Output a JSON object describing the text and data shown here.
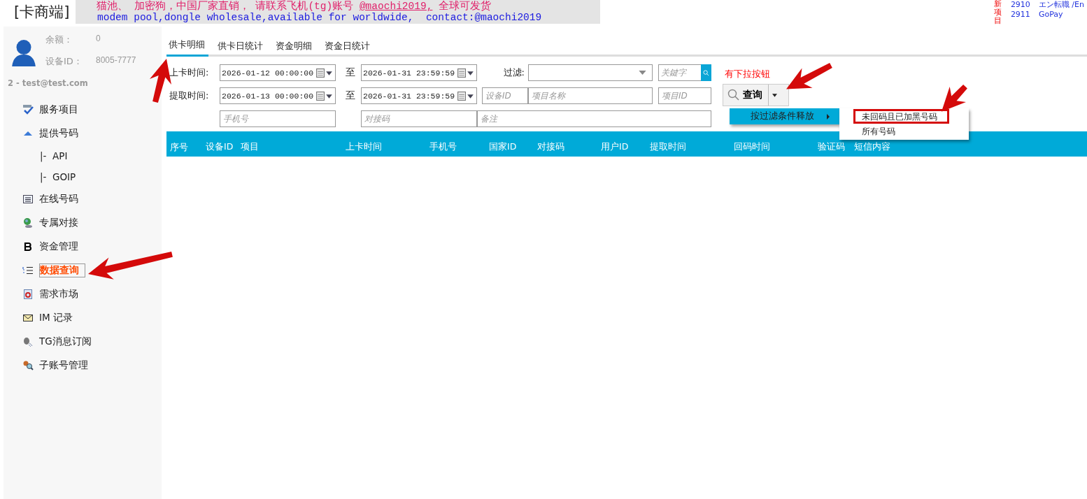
{
  "header": {
    "logo": "[卡商端]",
    "banner": {
      "line1_before": "猫池、 加密狗，中国厂家直销， 请联系飞机(tg)账号 ",
      "line1_link": "@maochi2019,",
      "line1_after": " 全球可发货",
      "line2": "modem pool,dongle wholesale,available for worldwide,  contact:@maochi2019"
    },
    "new_label": "新项目",
    "new_projects": [
      {
        "id": "2910",
        "name": "エン転職 /En"
      },
      {
        "id": "2911",
        "name": "GoPay"
      }
    ]
  },
  "account": {
    "balance_label": "余额：",
    "balance": "0",
    "device_label": "设备ID：",
    "device_id": "8005-7777",
    "user": "2 - test@test.com"
  },
  "nav": [
    {
      "label": "服务项目",
      "selected": false
    },
    {
      "label": "提供号码",
      "selected": false,
      "children": [
        {
          "label": "|-  API",
          "selected": false
        },
        {
          "label": "|-  GOIP",
          "selected": false
        }
      ]
    },
    {
      "label": "在线号码",
      "selected": false
    },
    {
      "label": "专属对接",
      "selected": false
    },
    {
      "label": "资金管理",
      "selected": false
    },
    {
      "label": "数据查询",
      "selected": true
    },
    {
      "label": "需求市场",
      "selected": false
    },
    {
      "label": "IM 记录",
      "selected": false
    },
    {
      "label": "TG消息订阅",
      "selected": false
    },
    {
      "label": "子账号管理",
      "selected": false
    }
  ],
  "tabs": [
    {
      "label": "供卡明细",
      "selected": true
    },
    {
      "label": "供卡日统计",
      "selected": false
    },
    {
      "label": "资金明细",
      "selected": false
    },
    {
      "label": "资金日统计",
      "selected": false
    }
  ],
  "filters": {
    "date_rows": [
      {
        "label": "上卡时间:",
        "from": "2026-01-12 00:00:00",
        "to_label": "至",
        "to": "2026-01-31 23:59:59"
      },
      {
        "label": "提取时间:",
        "from": "2026-01-13 00:00:00",
        "to_label": "至",
        "to": "2026-01-31 23:59:59"
      }
    ],
    "filter_label": "过滤:",
    "keyword_placeholder": "关鍵字",
    "device_placeholder": "设备ID",
    "project_name_placeholder": "项目名称",
    "project_id_placeholder": "项目ID",
    "phone_placeholder": "手机号",
    "code_placeholder": "对接码",
    "note_placeholder": "备注"
  },
  "query": {
    "note": "有下拉按钮",
    "label": "查询",
    "menu": [
      {
        "label": "按过滤条件释放",
        "expanded": true,
        "children": [
          {
            "label": "未回码且已加黑号码",
            "marked": true
          },
          {
            "label": "所有号码",
            "marked": false
          }
        ]
      }
    ]
  },
  "table": {
    "columns": [
      "序号",
      "设备ID",
      "项目",
      "上卡时间",
      "手机号",
      "国家ID",
      "对接码",
      "用户ID",
      "提取时间",
      "回码时间",
      "验证码",
      "短信内容"
    ]
  }
}
